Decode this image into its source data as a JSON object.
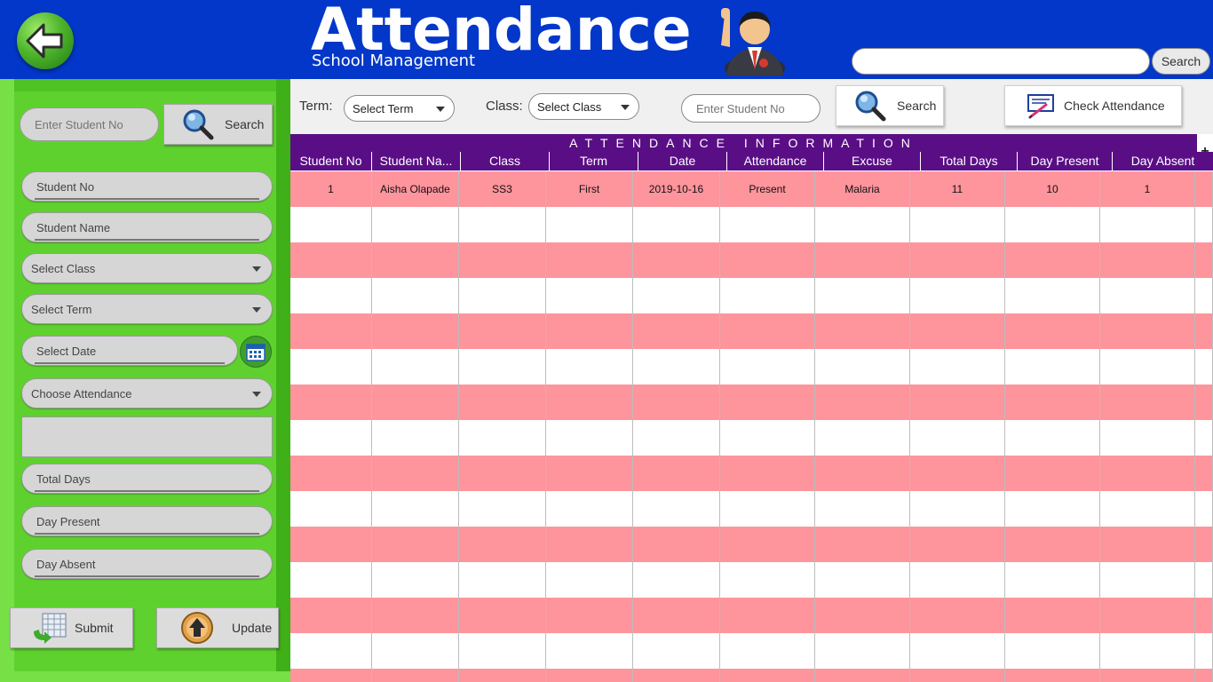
{
  "header": {
    "title": "Attendance",
    "subtitle": "School Management",
    "search_placeholder": "",
    "search_button": "Search"
  },
  "left_panel": {
    "search_placeholder": "Enter Student No",
    "search_button": "Search",
    "fields": {
      "student_no": "Student No",
      "student_name": "Student Name",
      "select_class": "Select Class",
      "select_term": "Select Term",
      "select_date": "Select Date",
      "choose_attendance": "Choose Attendance",
      "excuse_text": "",
      "total_days": "Total Days",
      "day_present": "Day Present",
      "day_absent": "Day Absent"
    },
    "submit_button": "Submit",
    "update_button": "Update"
  },
  "toolbar": {
    "term_label": "Term:",
    "term_select": "Select Term",
    "class_label": "Class:",
    "class_select": "Select Class",
    "student_no_placeholder": "Enter Student No",
    "search_button": "Search",
    "check_button": "Check Attendance"
  },
  "grid": {
    "title": "ATTENDANCE INFORMATION",
    "add_symbol": "+",
    "columns": [
      "Student No",
      "Student Na...",
      "Class",
      "Term",
      "Date",
      "Attendance",
      "Excuse",
      "Total Days",
      "Day Present",
      "Day Absent"
    ],
    "rows": [
      [
        "1",
        "Aisha Olapade",
        "SS3",
        "First",
        "2019-10-16",
        "Present",
        "Malaria",
        "11",
        "10",
        "1"
      ]
    ]
  },
  "colors": {
    "header_bg": "#0237c9",
    "panel_green": "#5fd12f",
    "grid_header": "#5a0e86",
    "row_pink": "#fe949c"
  },
  "icons": {
    "back": "back-arrow-icon",
    "search": "magnifier-icon",
    "calendar": "calendar-icon",
    "submit": "submit-grid-icon",
    "update": "upload-arrow-icon",
    "check": "certificate-icon"
  }
}
